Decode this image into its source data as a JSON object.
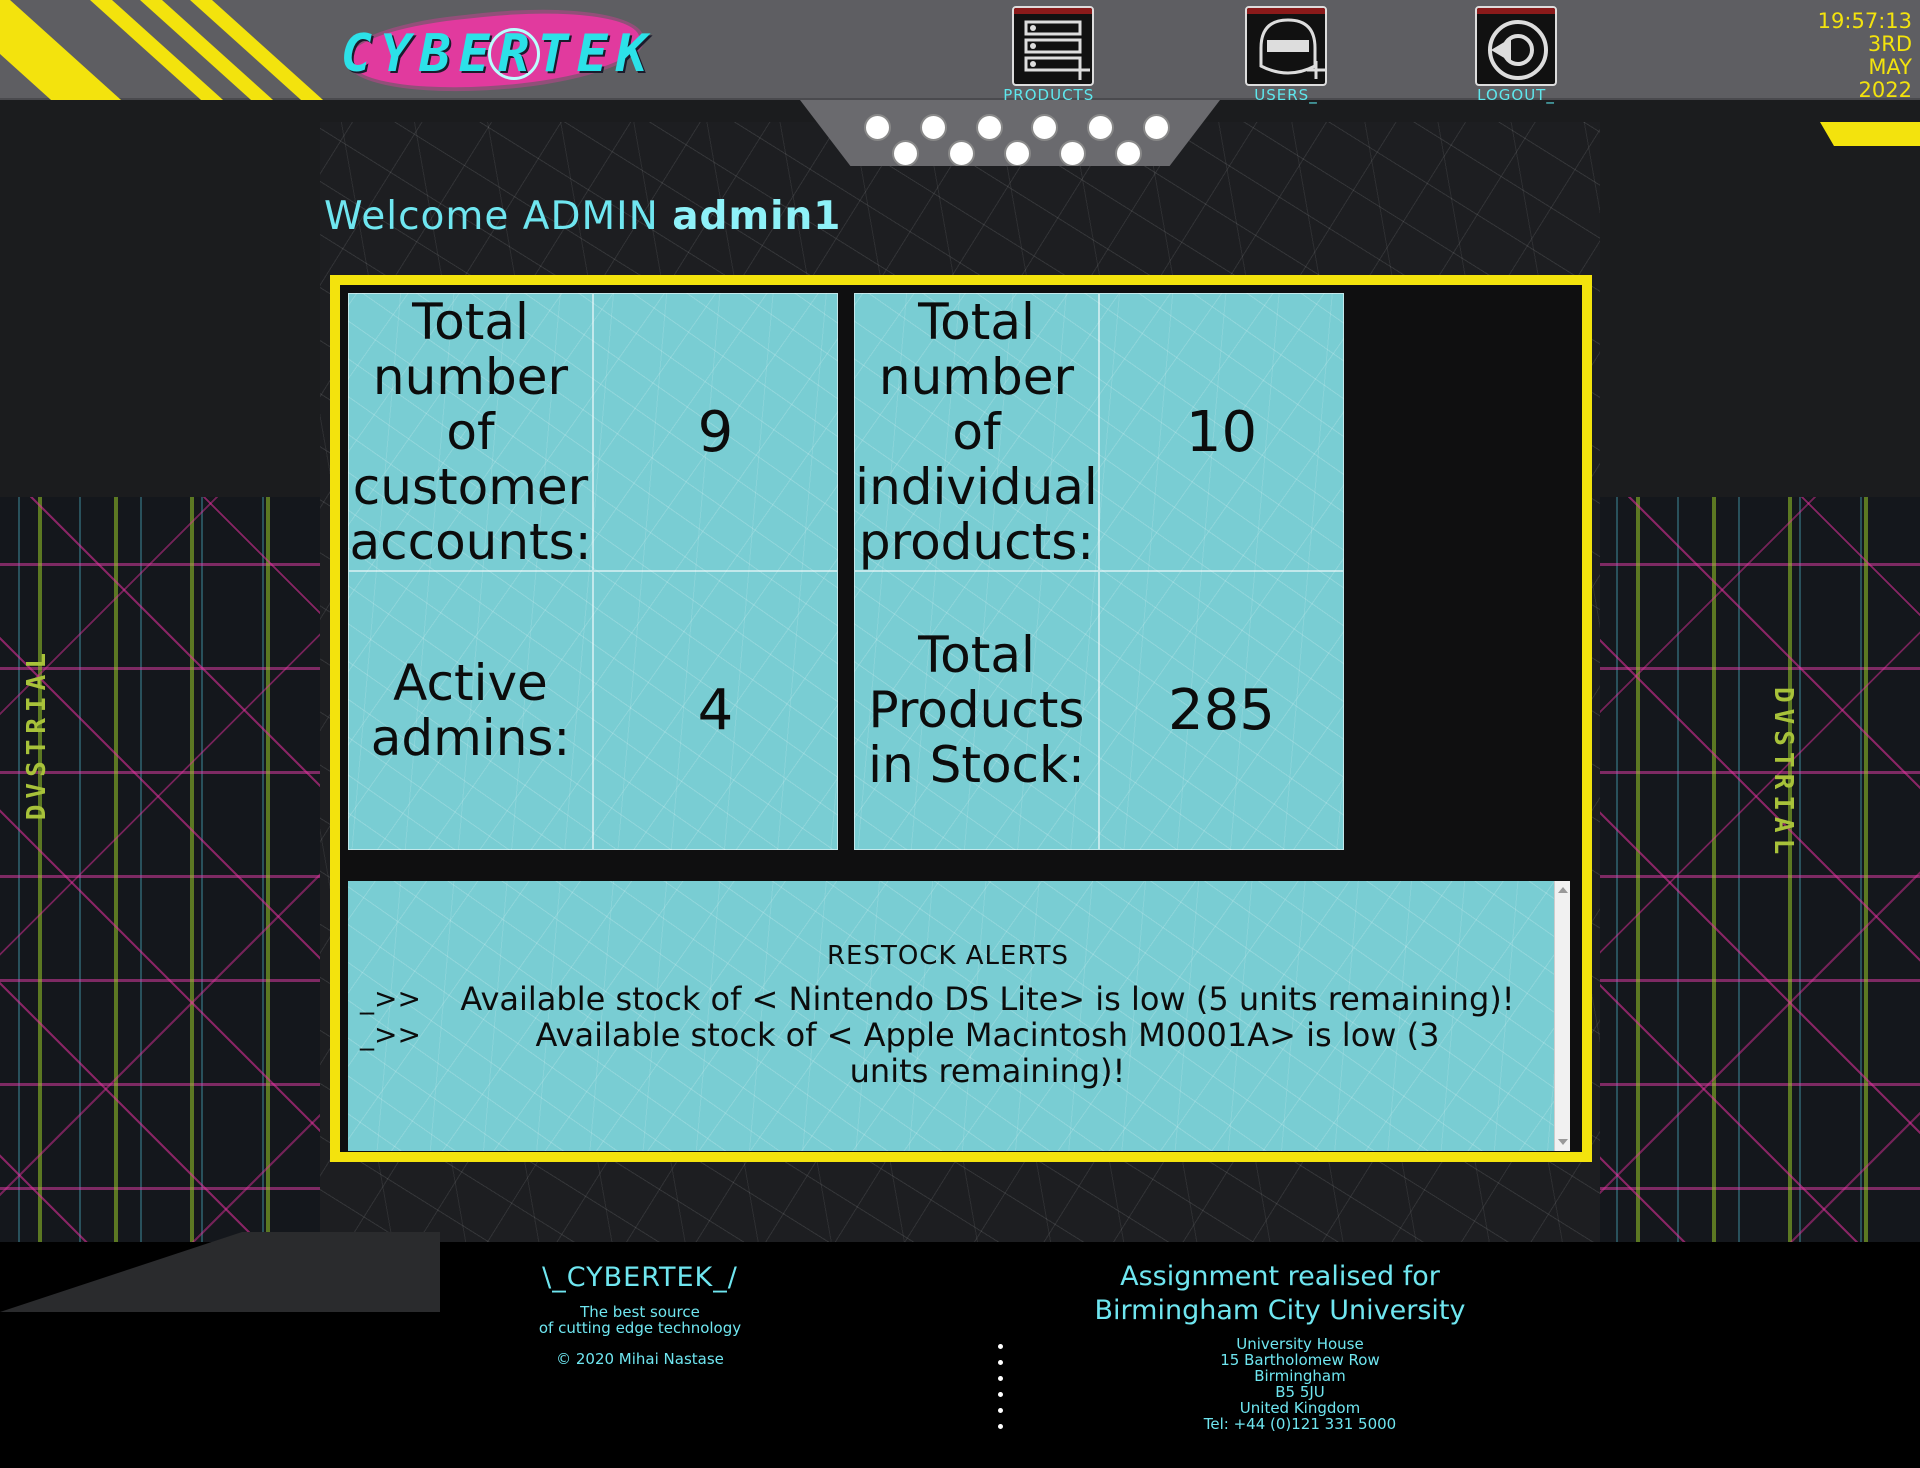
{
  "header": {
    "logo_text": "CYBERTEK",
    "nav": [
      {
        "label": "PRODUCTS_",
        "icon": "products-list-icon"
      },
      {
        "label": "USERS_",
        "icon": "user-helmet-icon"
      },
      {
        "label": "LOGOUT_",
        "icon": "logout-icon"
      }
    ],
    "clock": {
      "time": "19:57:13",
      "day": "3RD",
      "month": "MAY",
      "year": "2022"
    }
  },
  "side_text": "DVSTRIAL",
  "welcome": {
    "prefix": "Welcome ADMIN",
    "username": "admin1"
  },
  "stats": {
    "customers": {
      "label": "Total number of customer accounts:",
      "value": "9"
    },
    "products": {
      "label": "Total number of individual products:",
      "value": "10"
    },
    "admins": {
      "label": "Active admins:",
      "value": "4"
    },
    "stock": {
      "label": "Total Products in Stock:",
      "value": "285"
    }
  },
  "alerts": {
    "title": "RESTOCK ALERTS",
    "items": [
      {
        "prefix": "_>>",
        "text": "Available stock of < Nintendo DS Lite> is low (5 units remaining)!"
      },
      {
        "prefix": "_>>",
        "text": "Available stock of < Apple Macintosh M0001A> is low (3 units remaining)!"
      }
    ]
  },
  "footer": {
    "brand": "\\_CYBERTEK_/",
    "tagline_1": "The best source",
    "tagline_2": "of cutting edge technology",
    "copyright": "© 2020 Mihai Nastase",
    "assignment_1": "Assignment realised for",
    "assignment_2": "Birmingham City University",
    "address": [
      "University House",
      "15 Bartholomew Row",
      "Birmingham",
      "B5 5JU",
      "United Kingdom",
      "Tel: +44 (0)121 331 5000"
    ]
  },
  "colors": {
    "accent_yellow": "#f3e30d",
    "cyan_text": "#6fe6f0",
    "tile_cyan": "#79cdd3",
    "brand_pink": "#e13a9e"
  }
}
